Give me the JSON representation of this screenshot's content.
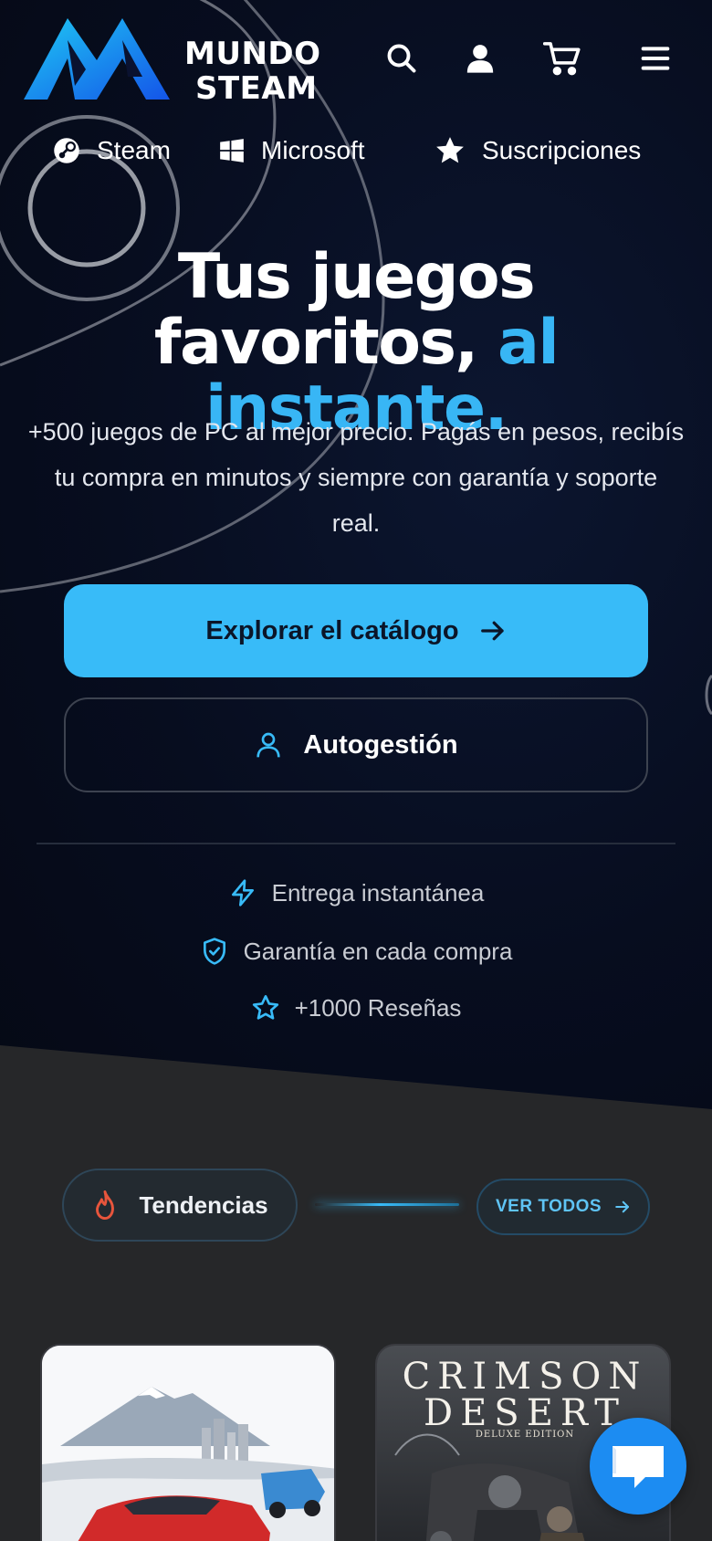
{
  "brand": {
    "line1": "MUNDO",
    "line2": "STEAM"
  },
  "header_icons": [
    "search-icon",
    "user-icon",
    "cart-icon",
    "menu-icon"
  ],
  "nav": {
    "items": [
      {
        "label": "Steam",
        "icon": "steam-icon"
      },
      {
        "label": "Microsoft",
        "icon": "windows-icon"
      },
      {
        "label": "Suscripciones",
        "icon": "star-icon"
      }
    ]
  },
  "hero": {
    "title_line1": "Tus juegos",
    "title_line2_a": "favoritos,",
    "title_line2_b": "al instante.",
    "subtitle": "+500 juegos de PC al mejor precio. Pagás en pesos, recibís tu compra en minutos y siempre con garantía y soporte real.",
    "primary_cta": "Explorar el catálogo",
    "secondary_cta": "Autogestión"
  },
  "features": [
    {
      "label": "Entrega instantánea",
      "icon": "bolt-icon"
    },
    {
      "label": "Garantía en cada compra",
      "icon": "shield-check-icon"
    },
    {
      "label": "+1000 Reseñas",
      "icon": "star-outline-icon"
    }
  ],
  "trending": {
    "label": "Tendencias",
    "icon": "fire-icon",
    "view_all": "VER TODOS"
  },
  "products": [
    {
      "title": "",
      "art": "red-sports-car-artwork"
    },
    {
      "title_line1": "CRIMSON",
      "title_line2": "DESERT",
      "edition": "DELUXE EDITION"
    }
  ],
  "colors": {
    "accent": "#38bbf8",
    "hero_bg": "#070d1f",
    "section_bg": "#262729",
    "chat_button": "#1c8cf2",
    "fire": "#e8553c"
  }
}
